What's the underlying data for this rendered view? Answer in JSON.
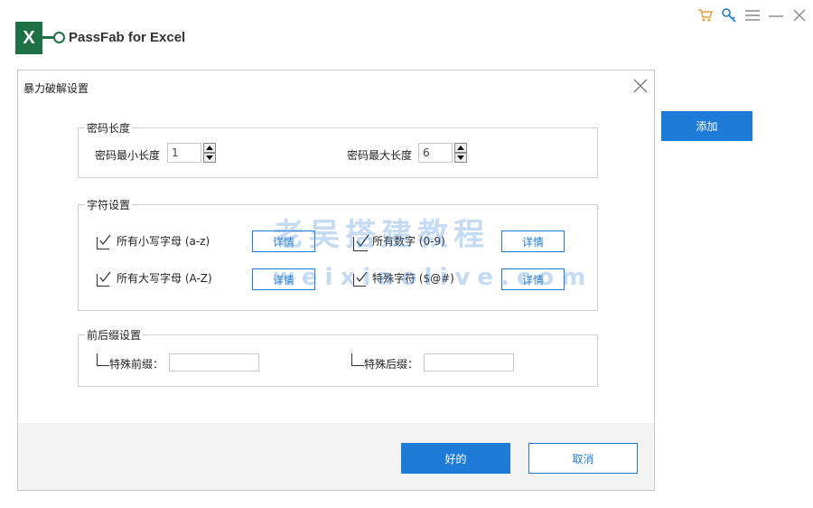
{
  "app": {
    "logo_letter": "X",
    "title": "PassFab for Excel",
    "add_button_label": "添加",
    "accent": "#1f7bd8",
    "brand_green": "#1e7145"
  },
  "top_icons": [
    "cart-icon",
    "key-icon",
    "menu-icon",
    "minimize-icon",
    "close-icon"
  ],
  "dialog": {
    "title": "暴力破解设置",
    "password_length": {
      "group_title": "密码长度",
      "min_label": "密码最小长度",
      "min_value": "1",
      "max_label": "密码最大长度",
      "max_value": "6"
    },
    "charset": {
      "group_title": "字符设置",
      "options": [
        {
          "label": "所有小写字母 (a-z)",
          "checked": true,
          "detail_label": "详情"
        },
        {
          "label": "所有数字 (0-9)",
          "checked": true,
          "detail_label": "详情"
        },
        {
          "label": "所有大写字母 (A-Z)",
          "checked": true,
          "detail_label": "详情"
        },
        {
          "label": "特殊字符 ($@#)",
          "checked": true,
          "detail_label": "详情"
        }
      ]
    },
    "affix": {
      "group_title": "前后缀设置",
      "prefix_label": "特殊前缀：",
      "prefix_value": "",
      "suffix_label": "特殊后缀：",
      "suffix_value": ""
    },
    "ok_label": "好的",
    "cancel_label": "取消"
  },
  "watermark": {
    "line1": "老吴搭建教程",
    "line2": "weixiaolive.com"
  }
}
